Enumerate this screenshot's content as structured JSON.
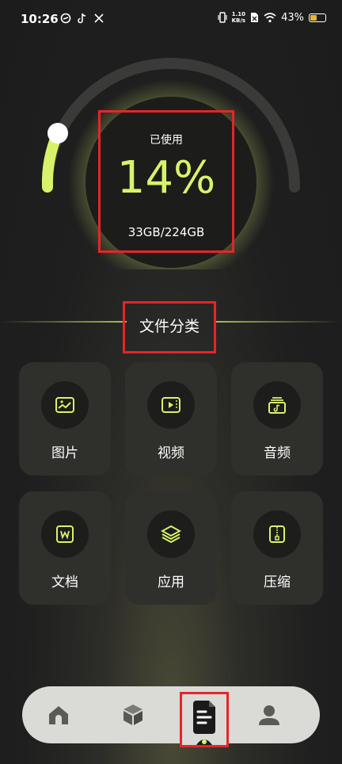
{
  "status_bar": {
    "time": "10:26",
    "speed_value": "1.10",
    "speed_unit": "KB/s",
    "battery_percent": "43%"
  },
  "storage": {
    "used_label": "已使用",
    "percent_text": "14%",
    "size_text": "33GB/224GB",
    "used_fraction": 0.14
  },
  "section": {
    "title": "文件分类"
  },
  "categories": [
    {
      "label": "图片",
      "icon": "image-icon"
    },
    {
      "label": "视频",
      "icon": "video-icon"
    },
    {
      "label": "音频",
      "icon": "audio-icon"
    },
    {
      "label": "文档",
      "icon": "document-icon"
    },
    {
      "label": "应用",
      "icon": "app-layers-icon"
    },
    {
      "label": "压缩",
      "icon": "zip-icon"
    }
  ],
  "nav": [
    {
      "icon": "home-icon"
    },
    {
      "icon": "cube-icon"
    },
    {
      "icon": "files-icon",
      "active": true
    },
    {
      "icon": "profile-icon"
    }
  ],
  "colors": {
    "accent": "#d8f36a",
    "highlight_box": "#e5252a",
    "tile_bg": "#2f2f2c",
    "nav_bg": "#dadad6"
  }
}
